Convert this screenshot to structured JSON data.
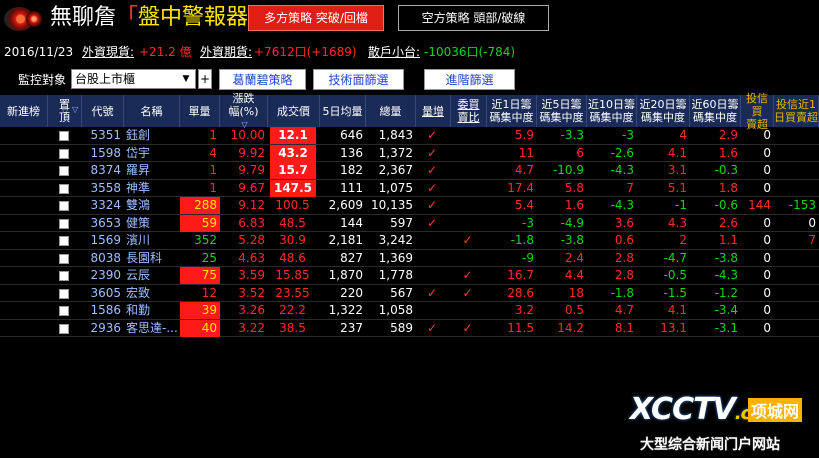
{
  "header": {
    "title_part1": "無聊詹",
    "title_part2": "「",
    "title_part3": "盤中警報器",
    "title_part4": "」",
    "tab_long": "多方策略  突破/回檔",
    "tab_short": "空方策略  頭部/破線"
  },
  "info": {
    "date": "2016/11/23",
    "spot_label": "外資現貨:",
    "spot_value": "+21.2 億",
    "futures_label": "外資期貨:",
    "futures_value": "+7612口(+1689)",
    "retail_label": "散戶小台:",
    "retail_value": "-10036口(-784)"
  },
  "controls": {
    "monitor_label": "監控對象",
    "select_value": "台股上市櫃",
    "plus_label": "+",
    "btn1": "葛蘭碧策略",
    "btn2": "技術面篩選",
    "btn3": "進階篩選"
  },
  "columns": [
    {
      "l1": "新進榜",
      "l2": ""
    },
    {
      "l1": "置",
      "l2": "頂"
    },
    {
      "l1": "代號",
      "l2": ""
    },
    {
      "l1": "名稱",
      "l2": ""
    },
    {
      "l1": "單量",
      "l2": ""
    },
    {
      "l1": "漲跌",
      "l2": "幅(%)"
    },
    {
      "l1": "成交價",
      "l2": ""
    },
    {
      "l1": "5日均量",
      "l2": ""
    },
    {
      "l1": "總量",
      "l2": ""
    },
    {
      "l1": "量增",
      "l2": ""
    },
    {
      "l1": "委買",
      "l2": "賣比"
    },
    {
      "l1": "近1日籌",
      "l2": "碼集中度"
    },
    {
      "l1": "近5日籌",
      "l2": "碼集中度"
    },
    {
      "l1": "近10日籌",
      "l2": "碼集中度"
    },
    {
      "l1": "近20日籌",
      "l2": "碼集中度"
    },
    {
      "l1": "近60日籌",
      "l2": "碼集中度"
    },
    {
      "l1": "投信買",
      "l2": "賣超"
    },
    {
      "l1": "投信近1",
      "l2": "日買賣超"
    }
  ],
  "rows": [
    {
      "code": "5351",
      "name": "鈺創",
      "vol": "1",
      "chg": "10.00",
      "price": "12.1",
      "avg5": "646",
      "total": "1,843",
      "vinc": true,
      "bidask": false,
      "c1": "5.9",
      "c5": "-3.3",
      "c10": "-3",
      "c20": "4",
      "c60": "2.9",
      "it": "0",
      "it1": ""
    },
    {
      "code": "1598",
      "name": "岱宇",
      "vol": "4",
      "chg": "9.92",
      "price": "43.2",
      "avg5": "136",
      "total": "1,372",
      "vinc": true,
      "bidask": false,
      "c1": "11",
      "c5": "6",
      "c10": "-2.6",
      "c20": "4.1",
      "c60": "1.6",
      "it": "0",
      "it1": ""
    },
    {
      "code": "8374",
      "name": "羅昇",
      "vol": "1",
      "chg": "9.79",
      "price": "15.7",
      "avg5": "182",
      "total": "2,367",
      "vinc": true,
      "bidask": false,
      "c1": "4.7",
      "c5": "-10.9",
      "c10": "-4.3",
      "c20": "3.1",
      "c60": "-0.3",
      "it": "0",
      "it1": ""
    },
    {
      "code": "3558",
      "name": "神準",
      "vol": "1",
      "chg": "9.67",
      "price": "147.5",
      "avg5": "111",
      "total": "1,075",
      "vinc": true,
      "bidask": false,
      "c1": "17.4",
      "c5": "5.8",
      "c10": "7",
      "c20": "5.1",
      "c60": "1.8",
      "it": "0",
      "it1": ""
    },
    {
      "code": "3324",
      "name": "雙鴻",
      "vol": "288",
      "chg": "9.12",
      "price": "100.5",
      "avg5": "2,609",
      "total": "10,135",
      "vinc": true,
      "bidask": false,
      "c1": "5.4",
      "c5": "1.6",
      "c10": "-4.3",
      "c20": "-1",
      "c60": "-0.6",
      "it": "144",
      "it1": "-153"
    },
    {
      "code": "3653",
      "name": "健策",
      "vol": "59",
      "chg": "6.83",
      "price": "48.5",
      "avg5": "144",
      "total": "597",
      "vinc": true,
      "bidask": false,
      "c1": "-3",
      "c5": "-4.9",
      "c10": "3.6",
      "c20": "4.3",
      "c60": "2.6",
      "it": "0",
      "it1": "0"
    },
    {
      "code": "1569",
      "name": "濱川",
      "vol": "352",
      "chg": "5.28",
      "price": "30.9",
      "avg5": "2,181",
      "total": "3,242",
      "vinc": false,
      "bidask": true,
      "c1": "-1.8",
      "c5": "-3.8",
      "c10": "0.6",
      "c20": "2",
      "c60": "1.1",
      "it": "0",
      "it1": "7"
    },
    {
      "code": "8038",
      "name": "長園科",
      "vol": "25",
      "chg": "4.63",
      "price": "48.6",
      "avg5": "827",
      "total": "1,369",
      "vinc": false,
      "bidask": false,
      "c1": "-9",
      "c5": "2.4",
      "c10": "2.8",
      "c20": "-4.7",
      "c60": "-3.8",
      "it": "0",
      "it1": ""
    },
    {
      "code": "2390",
      "name": "云辰",
      "vol": "75",
      "chg": "3.59",
      "price": "15.85",
      "avg5": "1,870",
      "total": "1,778",
      "vinc": false,
      "bidask": true,
      "c1": "16.7",
      "c5": "4.4",
      "c10": "2.8",
      "c20": "-0.5",
      "c60": "-4.3",
      "it": "0",
      "it1": ""
    },
    {
      "code": "3605",
      "name": "宏致",
      "vol": "12",
      "chg": "3.52",
      "price": "23.55",
      "avg5": "220",
      "total": "567",
      "vinc": true,
      "bidask": true,
      "c1": "28.6",
      "c5": "18",
      "c10": "-1.8",
      "c20": "-1.5",
      "c60": "-1.2",
      "it": "0",
      "it1": ""
    },
    {
      "code": "1586",
      "name": "和勤",
      "vol": "39",
      "chg": "3.26",
      "price": "22.2",
      "avg5": "1,322",
      "total": "1,058",
      "vinc": false,
      "bidask": false,
      "c1": "3.2",
      "c5": "0.5",
      "c10": "4.7",
      "c20": "4.1",
      "c60": "-3.4",
      "it": "0",
      "it1": ""
    },
    {
      "code": "2936",
      "name": "客思達-...",
      "vol": "40",
      "chg": "3.22",
      "price": "38.5",
      "avg5": "237",
      "total": "589",
      "vinc": true,
      "bidask": true,
      "c1": "11.5",
      "c5": "14.2",
      "c10": "8.1",
      "c20": "13.1",
      "c60": "-3.1",
      "it": "0",
      "it1": ""
    }
  ],
  "watermark": {
    "brand": "XCCTV",
    "brand_cn": ".cn",
    "side": "项城网",
    "sub": "大型综合新闻门户网站"
  },
  "colors": {
    "header_bg": "#1a2b57",
    "accent_red": "#ff1a1a",
    "positive": "#ff2a2a",
    "negative": "#19d21e",
    "highlight_yellow": "#ffe600"
  },
  "icons": {
    "logo": "red-lens-logo-icon",
    "select_arrow": "chevron-down-icon",
    "check": "checkmark-icon",
    "sort": "triangle-down-icon"
  }
}
